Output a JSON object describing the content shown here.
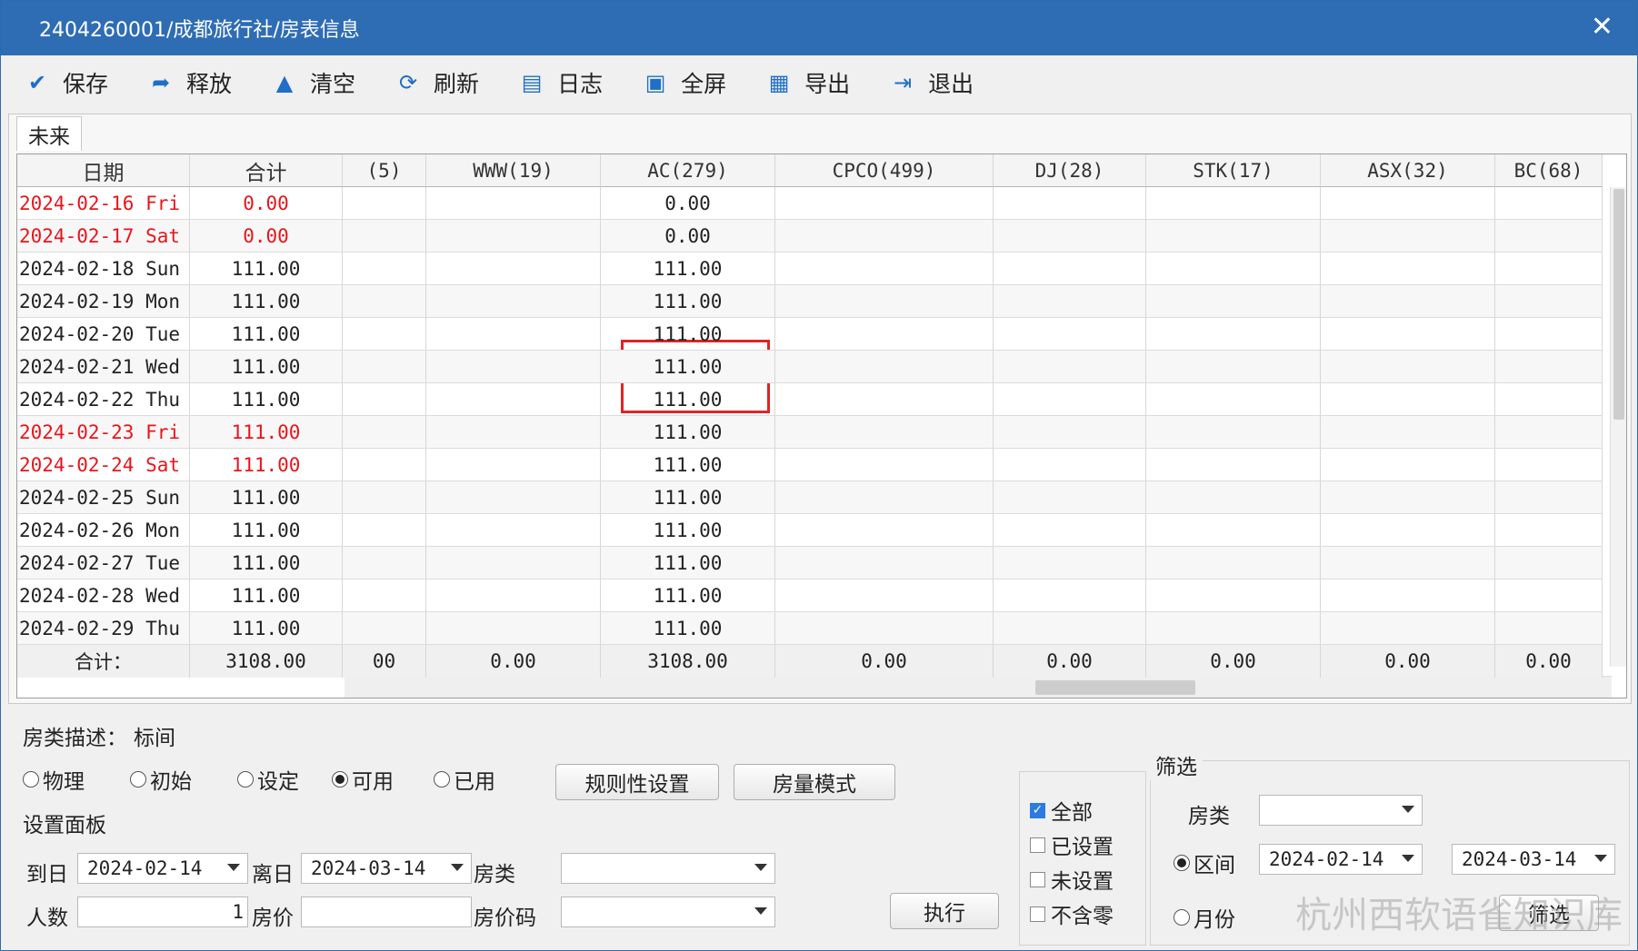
{
  "window": {
    "title": "2404260001/成都旅行社/房表信息",
    "close_glyph": "✕"
  },
  "toolbar": [
    {
      "label": "保存",
      "icon": "check-circle-icon",
      "glyph": "✔"
    },
    {
      "label": "释放",
      "icon": "release-icon",
      "glyph": "➦"
    },
    {
      "label": "清空",
      "icon": "clear-stamp-icon",
      "glyph": "▲"
    },
    {
      "label": "刷新",
      "icon": "refresh-icon",
      "glyph": "⟳"
    },
    {
      "label": "日志",
      "icon": "log-icon",
      "glyph": "▤"
    },
    {
      "label": "全屏",
      "icon": "fullscreen-icon",
      "glyph": "▣"
    },
    {
      "label": "导出",
      "icon": "export-save-icon",
      "glyph": "▦"
    },
    {
      "label": "退出",
      "icon": "exit-icon",
      "glyph": "⇥"
    }
  ],
  "tab": {
    "label": "未来"
  },
  "grid": {
    "headers": [
      "日期",
      "合计",
      "(5)",
      "WWW(19)",
      "AC(279)",
      "CPCO(499)",
      "DJ(28)",
      "STK(17)",
      "ASX(32)",
      "BC(68)"
    ],
    "rows": [
      {
        "date": "2024-02-16 Fri",
        "total": "0.00",
        "ac": "0.00",
        "weekend": true
      },
      {
        "date": "2024-02-17 Sat",
        "total": "0.00",
        "ac": "0.00",
        "weekend": true
      },
      {
        "date": "2024-02-18 Sun",
        "total": "111.00",
        "ac": "111.00",
        "weekend": false
      },
      {
        "date": "2024-02-19 Mon",
        "total": "111.00",
        "ac": "111.00",
        "weekend": false
      },
      {
        "date": "2024-02-20 Tue",
        "total": "111.00",
        "ac": "111.00",
        "weekend": false
      },
      {
        "date": "2024-02-21 Wed",
        "total": "111.00",
        "ac": "111.00",
        "weekend": false
      },
      {
        "date": "2024-02-22 Thu",
        "total": "111.00",
        "ac": "111.00",
        "weekend": false
      },
      {
        "date": "2024-02-23 Fri",
        "total": "111.00",
        "ac": "111.00",
        "weekend": true
      },
      {
        "date": "2024-02-24 Sat",
        "total": "111.00",
        "ac": "111.00",
        "weekend": true
      },
      {
        "date": "2024-02-25 Sun",
        "total": "111.00",
        "ac": "111.00",
        "weekend": false
      },
      {
        "date": "2024-02-26 Mon",
        "total": "111.00",
        "ac": "111.00",
        "weekend": false
      },
      {
        "date": "2024-02-27 Tue",
        "total": "111.00",
        "ac": "111.00",
        "weekend": false
      },
      {
        "date": "2024-02-28 Wed",
        "total": "111.00",
        "ac": "111.00",
        "weekend": false
      },
      {
        "date": "2024-02-29 Thu",
        "total": "111.00",
        "ac": "111.00",
        "weekend": false
      }
    ],
    "summary": [
      "合计：",
      "3108.00",
      "00",
      "0.00",
      "3108.00",
      "0.00",
      "0.00",
      "0.00",
      "0.00",
      "0.00"
    ]
  },
  "bottom": {
    "room_desc_label": "房类描述：",
    "room_desc_value": "标间",
    "modes": [
      {
        "label": "物理",
        "selected": false
      },
      {
        "label": "初始",
        "selected": false
      },
      {
        "label": "设定",
        "selected": false
      },
      {
        "label": "可用",
        "selected": true
      },
      {
        "label": "已用",
        "selected": false
      }
    ],
    "rule_button": "规则性设置",
    "quantity_button": "房量模式",
    "panel_title": "设置面板",
    "arrive_label": "到日",
    "arrive_value": "2024-02-14",
    "leave_label": "离日",
    "leave_value": "2024-03-14",
    "room_type_label": "房类",
    "people_label": "人数",
    "people_value": "1",
    "price_label": "房价",
    "price_code_label": "房价码",
    "execute_button": "执行",
    "checks": [
      {
        "label": "全部",
        "checked": true
      },
      {
        "label": "已设置",
        "checked": false
      },
      {
        "label": "未设置",
        "checked": false
      },
      {
        "label": "不含零",
        "checked": false
      }
    ],
    "filter_title": "筛选",
    "filter_room_type_label": "房类",
    "range_label": "区间",
    "range_from": "2024-02-14",
    "range_to": "2024-03-14",
    "month_label": "月份",
    "filter_button": "筛选"
  },
  "watermark": "杭州西软语雀知识库",
  "colors": {
    "titlebar": "#2e6db4",
    "accent": "#1f6fc6",
    "weekend_text": "#e8151b",
    "highlight_box": "#e02424"
  }
}
